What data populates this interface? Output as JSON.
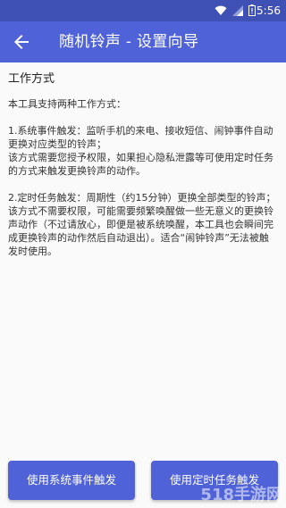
{
  "status_bar": {
    "time": "5:56",
    "icons": [
      "wifi-icon",
      "signal-icon",
      "battery-icon"
    ],
    "color": "#3f51b5"
  },
  "app_bar": {
    "title": "随机铃声 - 设置向导",
    "back_icon": "arrow-back-icon",
    "color": "#4f62d8"
  },
  "content": {
    "section_title": "工作方式",
    "intro": "本工具支持两种工作方式：",
    "mode1_desc": "1.系统事件触发：监听手机的来电、接收短信、闹钟事件自动更换对应类型的铃声；",
    "mode1_note": "该方式需要您授予权限，如果担心隐私泄露等可使用定时任务的方式来触发更换铃声的动作。",
    "mode2_desc": "2.定时任务触发：周期性（约15分钟）更换全部类型的铃声；",
    "mode2_note": "该方式不需要权限，可能需要频繁唤醒做一些无意义的更换铃声动作（不过请放心，即便是被系统唤醒，本工具也会瞬间完成更换铃声的动作然后自动退出）。适合“闹钟铃声”无法被触发时使用。"
  },
  "buttons": {
    "system_event": "使用系统事件触发",
    "scheduled_task": "使用定时任务触发"
  },
  "watermark": "518手游网"
}
